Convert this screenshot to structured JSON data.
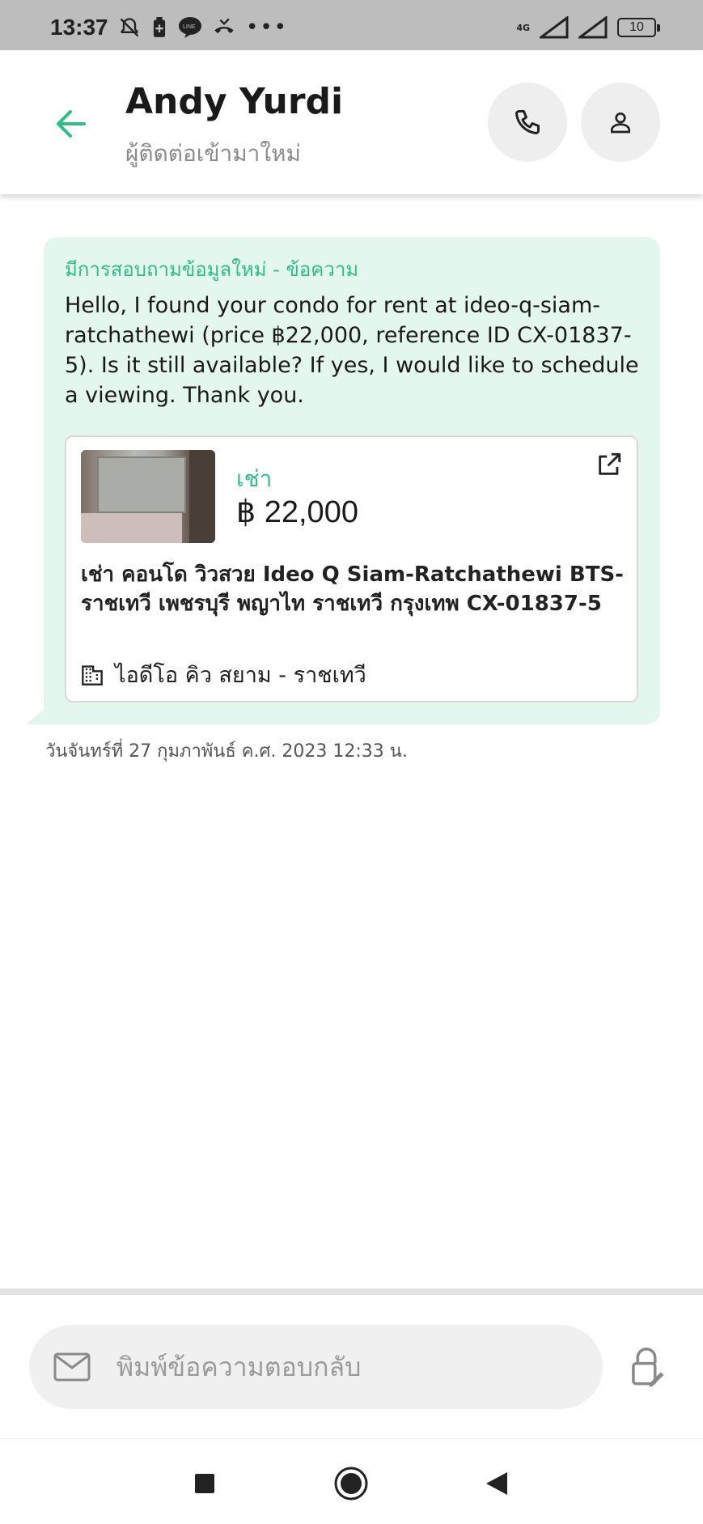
{
  "status_bar": {
    "time": "13:37",
    "signal_label": "4G",
    "battery": "10"
  },
  "header": {
    "contact_name": "Andy Yurdi",
    "contact_status": "ผู้ติดต่อเข้ามาใหม่"
  },
  "message": {
    "title": "มีการสอบถามข้อมูลใหม่ - ข้อความ",
    "body": "Hello, I found your condo for rent at ideo-q-siam-ratchathewi (price ฿22,000, reference ID CX-01837-5). Is it still available? If yes, I would like to schedule a viewing. Thank you.",
    "timestamp": "วันจันทร์ที่ 27 กุมภาพันธ์ ค.ศ. 2023 12:33 น."
  },
  "listing": {
    "type": "เช่า",
    "price": "฿ 22,000",
    "title": "เช่า คอนโด วิวสวย Ideo Q Siam-Ratchathewi BTS-ราชเทวี เพชรบุรี พญาไท ราชเทวี กรุงเทพ CX-01837-5",
    "project": "ไอดีโอ คิว สยาม - ราชเทวี"
  },
  "reply": {
    "placeholder": "พิมพ์ข้อความตอบกลับ"
  },
  "colors": {
    "accent": "#2ebd85",
    "bubble_bg": "#e4f7ef",
    "status_bar_bg": "#bdbdbd"
  },
  "icons": {
    "back": "arrow-left-icon",
    "call": "phone-icon",
    "profile": "person-icon",
    "open": "external-link-icon",
    "building": "building-icon",
    "mail": "mail-icon",
    "template": "lock-edit-icon"
  }
}
